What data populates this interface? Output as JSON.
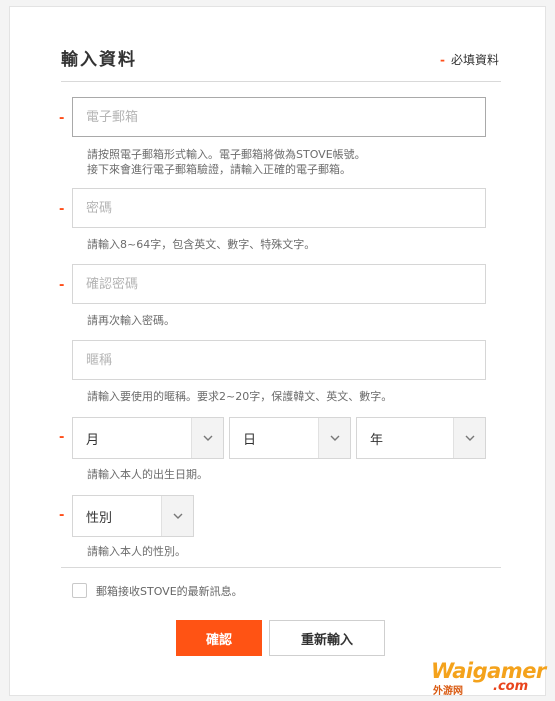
{
  "form": {
    "title": "輸入資料",
    "required_note": "必填資料",
    "required_marker": "-",
    "email": {
      "placeholder": "電子郵箱",
      "help_line1": "請按照電子郵箱形式輸入。電子郵箱將做為STOVE帳號。",
      "help_line2": "接下來會進行電子郵箱驗證，請輸入正確的電子郵箱。"
    },
    "password": {
      "placeholder": "密碼",
      "help": "請輸入8~64字，包含英文、數字、特殊文字。"
    },
    "confirm_password": {
      "placeholder": "確認密碼",
      "help": "請再次輸入密碼。"
    },
    "nickname": {
      "placeholder": "暱稱",
      "help": "請輸入要使用的暱稱。要求2~20字，保護韓文、英文、數字。"
    },
    "birth": {
      "month": "月",
      "day": "日",
      "year": "年",
      "help": "請輸入本人的出生日期。"
    },
    "gender": {
      "value": "性別",
      "help": "請輸入本人的性別。"
    },
    "newsletter_label": "郵箱接收STOVE的最新訊息。",
    "confirm_button": "確認",
    "reset_button": "重新輸入"
  },
  "watermark": {
    "main": "Waigamer",
    "sub": "外游网",
    "suffix": ".com"
  },
  "colors": {
    "accent": "#ff5314",
    "required": "#ff4e1a",
    "border": "#d6d6d6"
  },
  "icons": {
    "select_arrow": "chevron-down-icon"
  }
}
